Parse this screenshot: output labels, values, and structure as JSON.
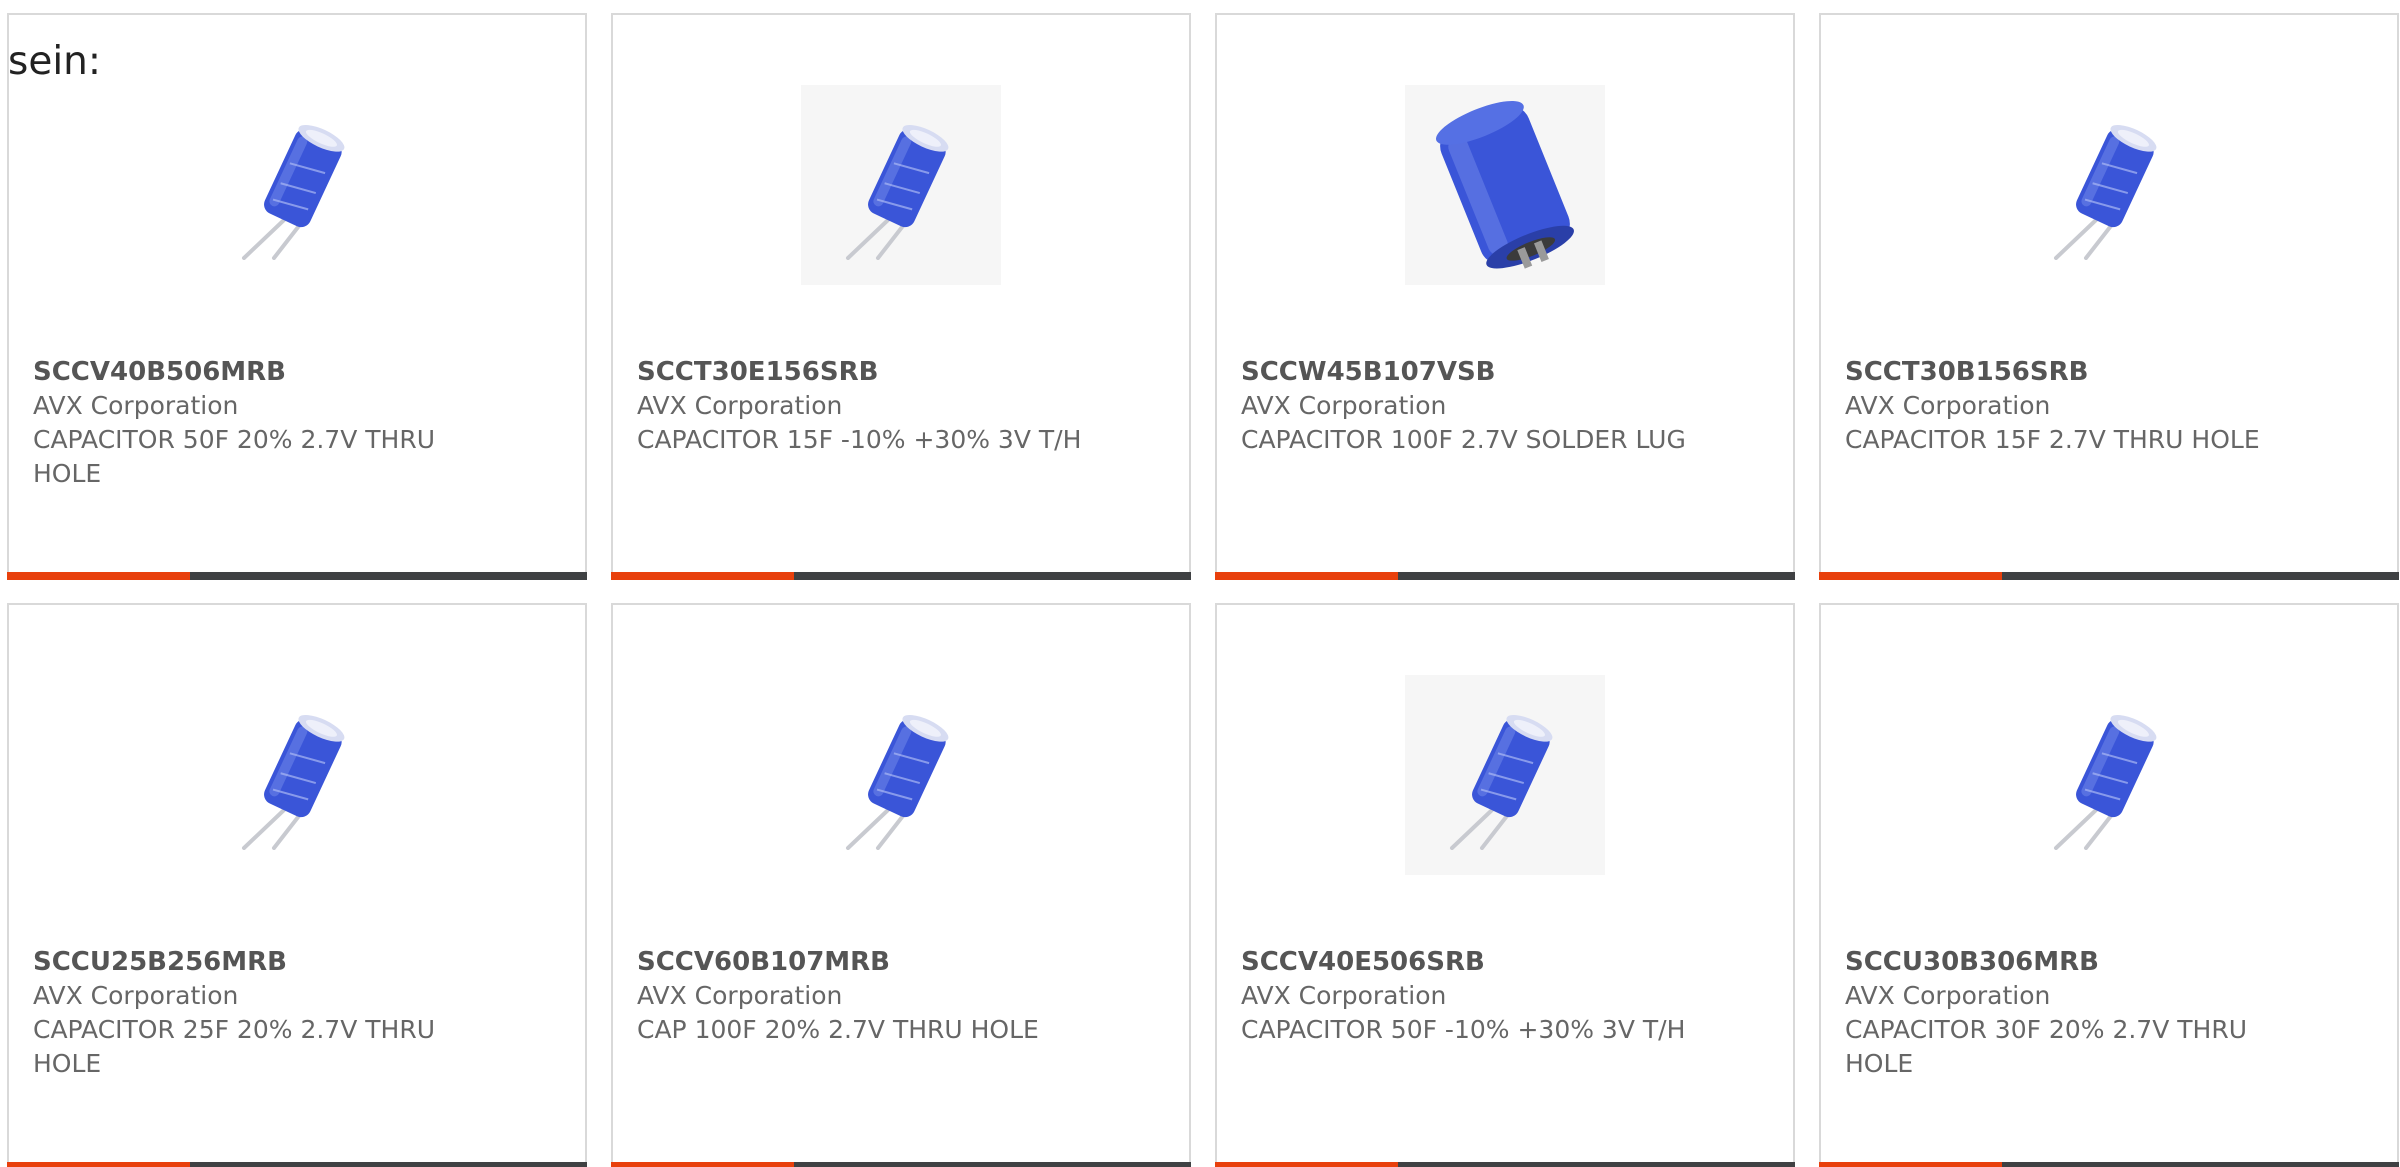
{
  "intro_text": "sein:",
  "colors": {
    "accent": "#e8400c",
    "bar_dark": "#3f4143",
    "text": "#666666",
    "capacitor_blue": "#3a55d8"
  },
  "accent_bar_fraction": 0.315,
  "products": [
    {
      "part_number": "SCCV40B506MRB",
      "manufacturer": "AVX Corporation",
      "description": "CAPACITOR 50F 20% 2.7V THRU HOLE",
      "image": "radial-capacitor-icon"
    },
    {
      "part_number": "SCCT30E156SRB",
      "manufacturer": "AVX Corporation",
      "description": "CAPACITOR 15F -10% +30% 3V T/H",
      "image": "radial-capacitor-icon"
    },
    {
      "part_number": "SCCW45B107VSB",
      "manufacturer": "AVX Corporation",
      "description": "CAPACITOR 100F 2.7V SOLDER LUG",
      "image": "solder-lug-capacitor-icon"
    },
    {
      "part_number": "SCCT30B156SRB",
      "manufacturer": "AVX Corporation",
      "description": "CAPACITOR 15F 2.7V THRU HOLE",
      "image": "radial-capacitor-icon"
    },
    {
      "part_number": "SCCU25B256MRB",
      "manufacturer": "AVX Corporation",
      "description": "CAPACITOR 25F 20% 2.7V THRU HOLE",
      "image": "radial-capacitor-icon"
    },
    {
      "part_number": "SCCV60B107MRB",
      "manufacturer": "AVX Corporation",
      "description": "CAP 100F 20% 2.7V THRU HOLE",
      "image": "radial-capacitor-icon"
    },
    {
      "part_number": "SCCV40E506SRB",
      "manufacturer": "AVX Corporation",
      "description": "CAPACITOR 50F -10% +30% 3V T/H",
      "image": "radial-capacitor-icon"
    },
    {
      "part_number": "SCCU30B306MRB",
      "manufacturer": "AVX Corporation",
      "description": "CAPACITOR 30F 20% 2.7V THRU HOLE",
      "image": "radial-capacitor-icon"
    }
  ]
}
